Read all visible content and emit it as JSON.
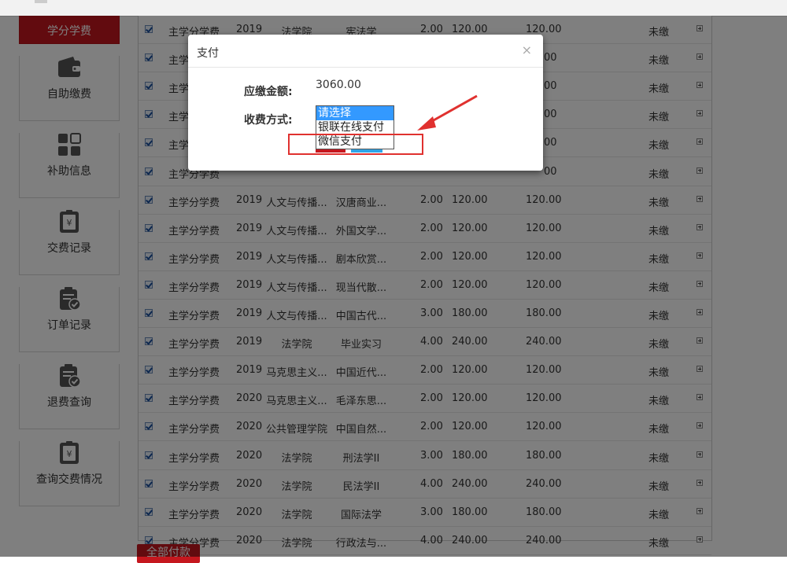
{
  "sidebar": {
    "active": "学分学费",
    "items": [
      {
        "label": "自助缴费",
        "icon": "wallet-icon"
      },
      {
        "label": "补助信息",
        "icon": "grid-icon"
      },
      {
        "label": "交费记录",
        "icon": "receipt-icon"
      },
      {
        "label": "订单记录",
        "icon": "clipboard-check-icon"
      },
      {
        "label": "退费查询",
        "icon": "clipboard-check-icon"
      },
      {
        "label": "查询交费情况",
        "icon": "receipt-icon"
      }
    ]
  },
  "table": {
    "rows": [
      [
        "主学分学费",
        "2019",
        "法学院",
        "宪法学",
        "2.00",
        "120.00",
        "120.00",
        "未缴"
      ],
      [
        "主学分学费",
        "",
        "",
        "",
        "",
        "",
        "",
        "未缴"
      ],
      [
        "主学分学费",
        "",
        "",
        "",
        "",
        "",
        "",
        "未缴"
      ],
      [
        "主学分学费",
        "",
        "",
        "",
        "",
        "",
        "",
        "未缴"
      ],
      [
        "主学分学费",
        "",
        "",
        "",
        "",
        "",
        "",
        "未缴"
      ],
      [
        "主学分学费",
        "",
        "",
        "",
        "",
        "",
        "",
        "未缴"
      ],
      [
        "主学分学费",
        "2019",
        "人文与传播...",
        "汉唐商业...",
        "2.00",
        "120.00",
        "120.00",
        "未缴"
      ],
      [
        "主学分学费",
        "2019",
        "人文与传播...",
        "外国文学...",
        "2.00",
        "120.00",
        "120.00",
        "未缴"
      ],
      [
        "主学分学费",
        "2019",
        "人文与传播...",
        "剧本欣赏...",
        "2.00",
        "120.00",
        "120.00",
        "未缴"
      ],
      [
        "主学分学费",
        "2019",
        "人文与传播...",
        "现当代散...",
        "2.00",
        "120.00",
        "120.00",
        "未缴"
      ],
      [
        "主学分学费",
        "2019",
        "人文与传播...",
        "中国古代...",
        "3.00",
        "180.00",
        "180.00",
        "未缴"
      ],
      [
        "主学分学费",
        "2019",
        "法学院",
        "毕业实习",
        "4.00",
        "240.00",
        "240.00",
        "未缴"
      ],
      [
        "主学分学费",
        "2019",
        "马克思主义...",
        "中国近代...",
        "2.00",
        "120.00",
        "120.00",
        "未缴"
      ],
      [
        "主学分学费",
        "2020",
        "马克思主义...",
        "毛泽东思...",
        "2.00",
        "120.00",
        "120.00",
        "未缴"
      ],
      [
        "主学分学费",
        "2020",
        "公共管理学院",
        "中国自然...",
        "2.00",
        "120.00",
        "120.00",
        "未缴"
      ],
      [
        "主学分学费",
        "2020",
        "法学院",
        "刑法学II",
        "3.00",
        "180.00",
        "180.00",
        "未缴"
      ],
      [
        "主学分学费",
        "2020",
        "法学院",
        "民法学II",
        "4.00",
        "240.00",
        "240.00",
        "未缴"
      ],
      [
        "主学分学费",
        "2020",
        "法学院",
        "国际法学",
        "3.00",
        "180.00",
        "180.00",
        "未缴"
      ],
      [
        "主学分学费",
        "2020",
        "法学院",
        "行政法与...",
        "4.00",
        "240.00",
        "240.00",
        "未缴"
      ]
    ],
    "partial_amounts": [
      "00",
      "00",
      "00",
      "00",
      "00"
    ]
  },
  "pay_all_button": "全部付款",
  "modal": {
    "title": "支付",
    "close": "×",
    "amount_label": "应缴金额:",
    "amount_value": "3060.00",
    "method_label": "收费方式:",
    "options": [
      "请选择",
      "银联在线支付",
      "微信支付"
    ],
    "selected_index": 0
  },
  "colors": {
    "brand_red": "#c5171e",
    "highlight_blue": "#3399ff",
    "annotation_red": "#e0312f"
  }
}
